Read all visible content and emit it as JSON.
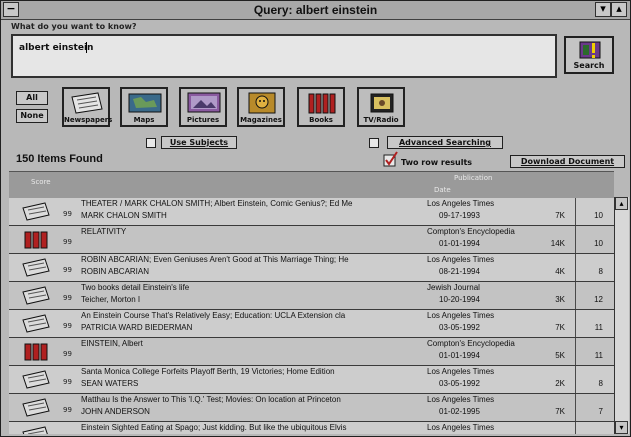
{
  "window": {
    "title": "Query: albert einstein"
  },
  "query": {
    "prompt": "What do you want to know?",
    "value": "albert einstein"
  },
  "search": {
    "label": "Search"
  },
  "filters": {
    "all_label": "All",
    "none_label": "None"
  },
  "categories": [
    {
      "label": "Newspapers",
      "icon": "newspaper-icon"
    },
    {
      "label": "Maps",
      "icon": "map-icon"
    },
    {
      "label": "Pictures",
      "icon": "picture-icon"
    },
    {
      "label": "Magazines",
      "icon": "magazine-icon"
    },
    {
      "label": "Books",
      "icon": "books-icon"
    },
    {
      "label": "TV/Radio",
      "icon": "tv-radio-icon"
    }
  ],
  "options": {
    "use_subjects": "Use Subjects",
    "advanced_searching": "Advanced Searching",
    "two_row_results": "Two row results",
    "download_document": "Download Document",
    "two_row_checked": true
  },
  "results": {
    "count_text": "150 Items Found",
    "headers": {
      "score": "Score",
      "publication": "Publication",
      "date": "Date"
    },
    "rows": [
      {
        "type": "newspaper",
        "score": "99",
        "title": "THEATER / MARK CHALON SMITH; Albert Einstein, Comic Genius?; Ed Me",
        "publication": "Los Angeles Times",
        "author": "MARK CHALON SMITH",
        "date": "09-17-1993",
        "size": "7K",
        "pages": "10"
      },
      {
        "type": "book",
        "score": "99",
        "title": "RELATIVITY",
        "publication": "Compton's Encyclopedia",
        "author": "",
        "date": "01-01-1994",
        "size": "14K",
        "pages": "10"
      },
      {
        "type": "newspaper",
        "score": "99",
        "title": "ROBIN ABCARIAN; Even Geniuses Aren't Good at This Marriage Thing; He",
        "publication": "Los Angeles Times",
        "author": "ROBIN ABCARIAN",
        "date": "08-21-1994",
        "size": "4K",
        "pages": "8"
      },
      {
        "type": "newspaper",
        "score": "99",
        "title": "Two books detail Einstein's life",
        "publication": "Jewish Journal",
        "author": "Teicher, Morton I",
        "date": "10-20-1994",
        "size": "3K",
        "pages": "12"
      },
      {
        "type": "newspaper",
        "score": "99",
        "title": "An Einstein Course That's Relatively Easy; Education: UCLA Extension cla",
        "publication": "Los Angeles Times",
        "author": "PATRICIA WARD BIEDERMAN",
        "date": "03-05-1992",
        "size": "7K",
        "pages": "11"
      },
      {
        "type": "book",
        "score": "99",
        "title": "EINSTEIN, Albert",
        "publication": "Compton's Encyclopedia",
        "author": "",
        "date": "01-01-1994",
        "size": "5K",
        "pages": "11"
      },
      {
        "type": "newspaper",
        "score": "99",
        "title": "Santa Monica College Forfeits Playoff Berth, 19 Victories; Home Edition",
        "publication": "Los Angeles Times",
        "author": "SEAN WATERS",
        "date": "03-05-1992",
        "size": "2K",
        "pages": "8"
      },
      {
        "type": "newspaper",
        "score": "99",
        "title": "Matthau Is the Answer to This 'I.Q.' Test; Movies: On location at Princeton",
        "publication": "Los Angeles Times",
        "author": "JOHN ANDERSON",
        "date": "01-02-1995",
        "size": "7K",
        "pages": "7"
      },
      {
        "type": "newspaper",
        "score": "99",
        "title": "Einstein Sighted Eating at Spago; Just kidding. But like the ubiquitous Elvis",
        "publication": "Los Angeles Times",
        "author": "",
        "date": "",
        "size": "",
        "pages": ""
      }
    ]
  }
}
